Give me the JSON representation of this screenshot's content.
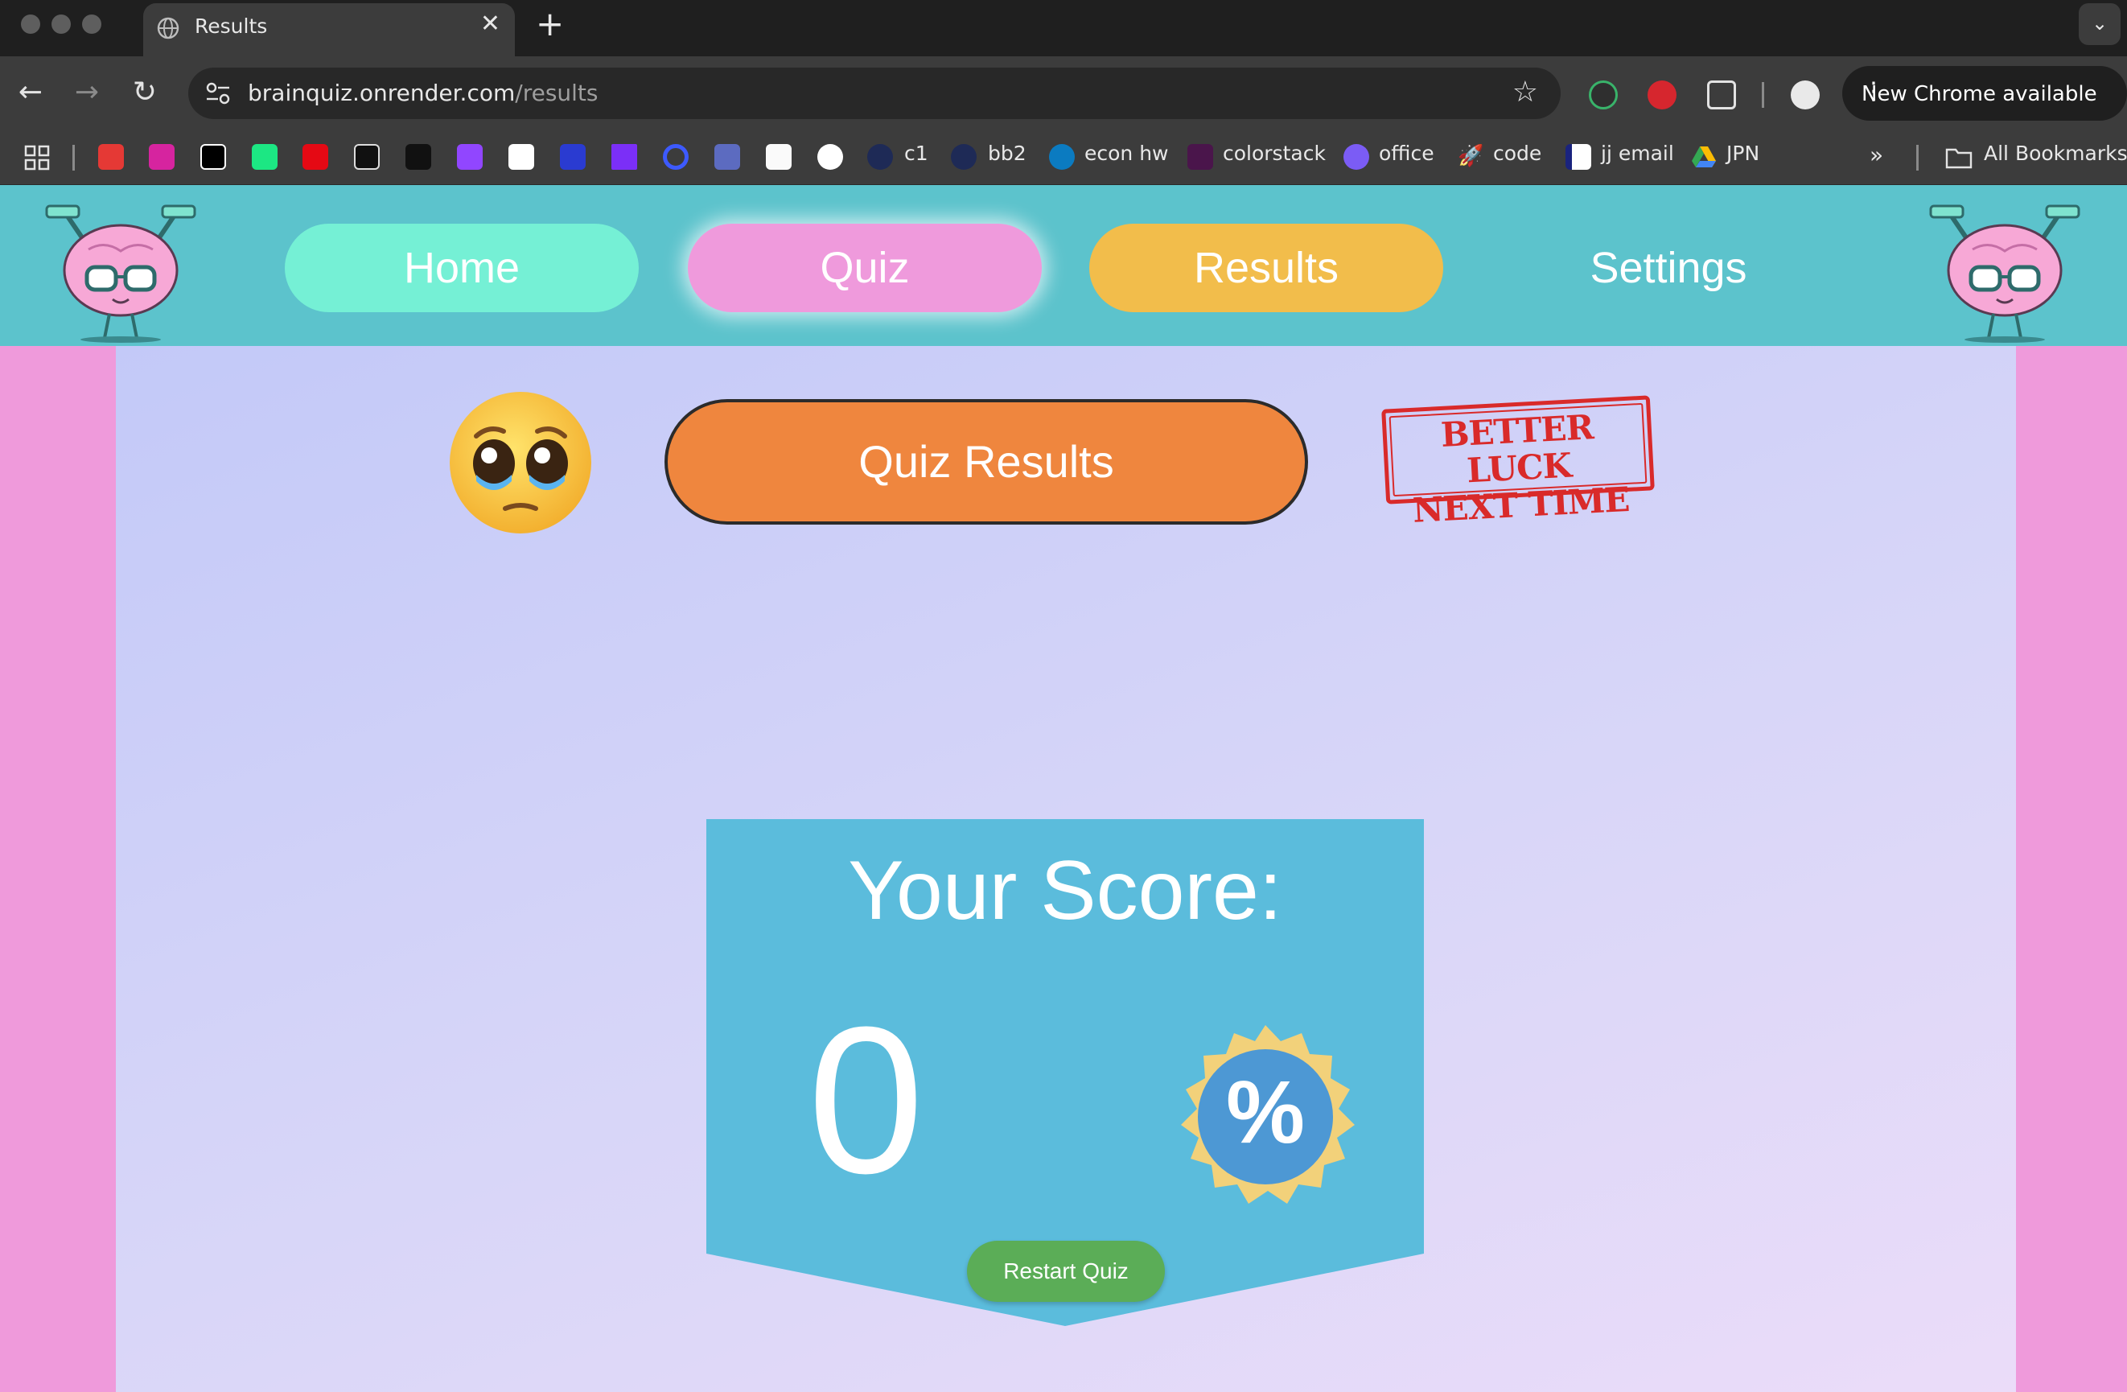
{
  "browser": {
    "tab_title": "Results",
    "url_host": "brainquiz.onrender.com",
    "url_path": "/results",
    "update_label": "New Chrome available",
    "bookmarks": [
      {
        "label": "c1",
        "icon": "bookmark-page-icon"
      },
      {
        "label": "bb2",
        "icon": "bookmark-page-icon"
      },
      {
        "label": "econ hw",
        "icon": "pearson-icon"
      },
      {
        "label": "colorstack",
        "icon": "slack-icon"
      },
      {
        "label": "office",
        "icon": "office-icon"
      },
      {
        "label": "code",
        "icon": "rocket-icon"
      },
      {
        "label": "jj email",
        "icon": "mail-icon"
      },
      {
        "label": "JPN",
        "icon": "drive-icon"
      }
    ],
    "all_bookmarks_label": "All Bookmarks"
  },
  "nav": {
    "home": "Home",
    "quiz": "Quiz",
    "results": "Results",
    "settings": "Settings"
  },
  "results": {
    "title": "Quiz Results",
    "stamp_line1": "BETTER LUCK",
    "stamp_line2": "NEXT TIME",
    "score_label": "Your Score:",
    "score_value": "0",
    "percent_symbol": "%",
    "restart_label": "Restart Quiz"
  },
  "colors": {
    "header_bg": "#5cc3cc",
    "home_pill": "#75f0d5",
    "quiz_pill": "#ef9adc",
    "results_pill": "#f2bd4b",
    "title_button": "#ef863e",
    "score_ribbon": "#5bbcdc",
    "restart_button": "#5bad57",
    "side_margin": "#ef9adb"
  }
}
